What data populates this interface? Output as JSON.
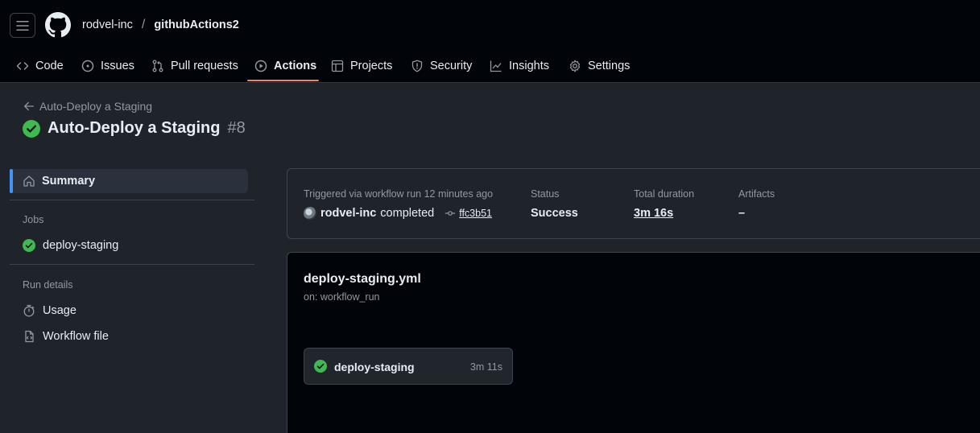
{
  "repo": {
    "owner": "rodvel-inc",
    "separator": "/",
    "name": "githubActions2"
  },
  "nav": {
    "code": "Code",
    "issues": "Issues",
    "pulls": "Pull requests",
    "actions": "Actions",
    "projects": "Projects",
    "security": "Security",
    "insights": "Insights",
    "settings": "Settings"
  },
  "run": {
    "back_label": "Auto-Deploy a Staging",
    "title": "Auto-Deploy a Staging",
    "number": "#8"
  },
  "sidebar": {
    "summary": "Summary",
    "jobs_heading": "Jobs",
    "job": "deploy-staging",
    "run_details_heading": "Run details",
    "usage": "Usage",
    "workflow_file": "Workflow file"
  },
  "summary": {
    "trigger_label": "Triggered via workflow run 12 minutes ago",
    "actor": "rodvel-inc",
    "action": "completed",
    "commit": "ffc3b51",
    "status_label": "Status",
    "status_value": "Success",
    "duration_label": "Total duration",
    "duration_value": "3m 16s",
    "artifacts_label": "Artifacts",
    "artifacts_value": "–"
  },
  "graph": {
    "file": "deploy-staging.yml",
    "trigger": "on: workflow_run",
    "job_name": "deploy-staging",
    "job_duration": "3m 11s"
  },
  "colors": {
    "accent_underline": "#f78166",
    "success": "#3fb950",
    "selected_bar": "#4493f8"
  }
}
